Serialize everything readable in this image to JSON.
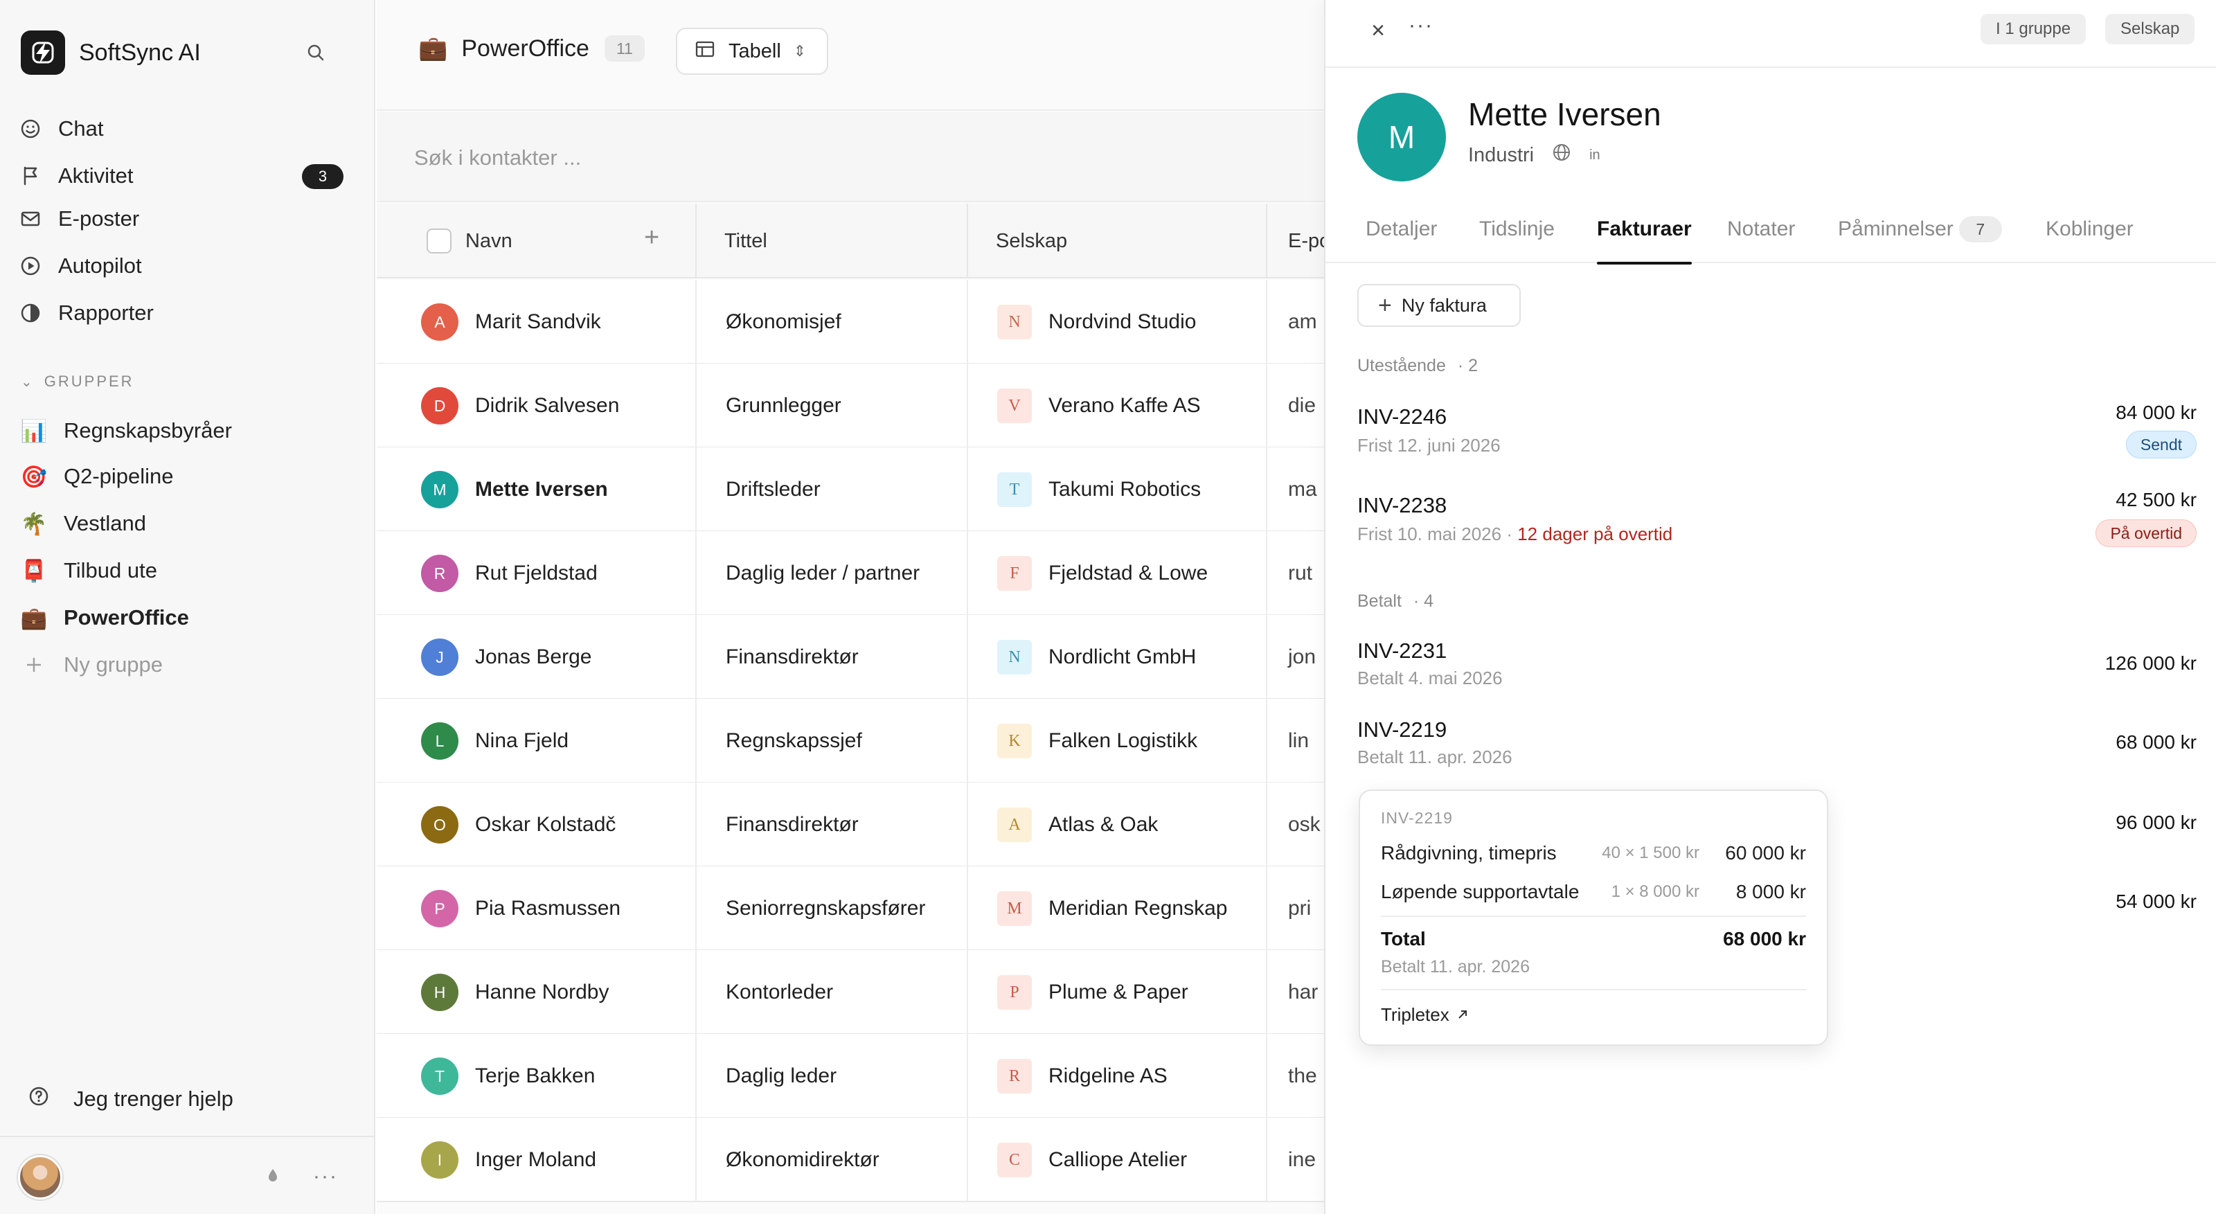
{
  "app": {
    "name": "SoftSync AI"
  },
  "nav": [
    {
      "label": "Chat",
      "icon": "smile-icon"
    },
    {
      "label": "Aktivitet",
      "icon": "flag-icon",
      "badge": "3"
    },
    {
      "label": "E-poster",
      "icon": "mail-icon"
    },
    {
      "label": "Autopilot",
      "icon": "play-circle-icon"
    },
    {
      "label": "Rapporter",
      "icon": "pie-chart-icon"
    }
  ],
  "groups": {
    "header": "GRUPPER",
    "items": [
      {
        "label": "Regnskapsbyråer",
        "emoji": "📊"
      },
      {
        "label": "Q2-pipeline",
        "emoji": "🎯"
      },
      {
        "label": "Vestland",
        "emoji": "🌴"
      },
      {
        "label": "Tilbud ute",
        "emoji": "📮"
      },
      {
        "label": "PowerOffice",
        "emoji": "💼"
      }
    ],
    "new_label": "Ny gruppe"
  },
  "help_label": "Jeg trenger hjelp",
  "main": {
    "title": "PowerOffice",
    "title_emoji": "💼",
    "count": "11",
    "view_label": "Tabell",
    "search_placeholder": "Søk i kontakter ...",
    "columns": [
      "Navn",
      "Tittel",
      "Selskap",
      "E-post"
    ],
    "rows": [
      {
        "initial": "A",
        "color": "#e4604a",
        "name": "Marit Sandvik",
        "title": "Økonomisjef",
        "logo": "N",
        "logo_bg": "#fde8e1",
        "logo_fg": "#c46a4a",
        "company": "Nordvind Studio",
        "email": "am"
      },
      {
        "initial": "D",
        "color": "#e14a3b",
        "name": "Didrik Salvesen",
        "title": "Grunnlegger",
        "logo": "V",
        "logo_bg": "#fde6e1",
        "logo_fg": "#c55c48",
        "company": "Verano Kaffe AS",
        "email": "die"
      },
      {
        "initial": "M",
        "color": "#17a19b",
        "name": "Mette Iversen",
        "title": "Driftsleder",
        "logo": "T",
        "logo_bg": "#dff3fb",
        "logo_fg": "#3a8fb0",
        "company": "Takumi Robotics",
        "email": "ma"
      },
      {
        "initial": "R",
        "color": "#c25aa5",
        "name": "Rut Fjeldstad",
        "title": "Daglig leder / partner",
        "logo": "F",
        "logo_bg": "#fde6e1",
        "logo_fg": "#c55c48",
        "company": "Fjeldstad & Lowe",
        "email": "rut"
      },
      {
        "initial": "J",
        "color": "#4f7fd6",
        "name": "Jonas Berge",
        "title": "Finansdirektør",
        "logo": "N",
        "logo_bg": "#dff3fb",
        "logo_fg": "#3a8fb0",
        "company": "Nordlicht GmbH",
        "email": "jon"
      },
      {
        "initial": "L",
        "color": "#2e8b4a",
        "name": "Nina Fjeld",
        "title": "Regnskapssjef",
        "logo": "K",
        "logo_bg": "#fdf0d8",
        "logo_fg": "#b5852e",
        "company": "Falken Logistikk",
        "email": "lin"
      },
      {
        "initial": "O",
        "color": "#8b6a12",
        "name": "Oskar Kolstadč",
        "title": "Finansdirektør",
        "logo": "A",
        "logo_bg": "#fdf0d8",
        "logo_fg": "#b5852e",
        "company": "Atlas & Oak",
        "email": "osk"
      },
      {
        "initial": "P",
        "color": "#d466a8",
        "name": "Pia Rasmussen",
        "title": "Seniorregnskapsfører",
        "logo": "M",
        "logo_bg": "#fde6e1",
        "logo_fg": "#c55c48",
        "company": "Meridian Regnskap",
        "email": "pri"
      },
      {
        "initial": "H",
        "color": "#5e7a3a",
        "name": "Hanne Nordby",
        "title": "Kontorleder",
        "logo": "P",
        "logo_bg": "#fde6e1",
        "logo_fg": "#c55c48",
        "company": "Plume & Paper",
        "email": "har"
      },
      {
        "initial": "T",
        "color": "#3fb89a",
        "name": "Terje Bakken",
        "title": "Daglig leder",
        "logo": "R",
        "logo_bg": "#fde6e1",
        "logo_fg": "#c55c48",
        "company": "Ridgeline AS",
        "email": "the"
      },
      {
        "initial": "I",
        "color": "#a8a64a",
        "name": "Inger Moland",
        "title": "Økonomidirektør",
        "logo": "C",
        "logo_bg": "#fde6e1",
        "logo_fg": "#c55c48",
        "company": "Calliope Atelier",
        "email": "ine"
      }
    ]
  },
  "panel": {
    "chips": [
      "I 1 gruppe",
      "Selskap"
    ],
    "initial": "M",
    "name": "Mette Iversen",
    "industry": "Industri",
    "linkedin": "in",
    "tabs": [
      "Detaljer",
      "Tidslinje",
      "Fakturaer",
      "Notater",
      "Påminnelser",
      "Koblinger"
    ],
    "reminder_count": "7",
    "new_invoice_label": "Ny faktura",
    "outstanding": {
      "label": "Utestående",
      "count": "· 2",
      "invoices": [
        {
          "no": "INV-2246",
          "sub": "Frist 12. juni 2026",
          "amount": "84 000 kr",
          "status": "Sendt"
        },
        {
          "no": "INV-2238",
          "sub": "Frist 10. mai 2026 ·",
          "overdue_note": "12 dager på overtid",
          "amount": "42 500 kr",
          "status": "På overtid"
        }
      ]
    },
    "paid": {
      "label": "Betalt",
      "count": "· 4",
      "invoices": [
        {
          "no": "INV-2231",
          "sub": "Betalt 4. mai 2026",
          "amount": "126 000 kr"
        },
        {
          "no": "INV-2219",
          "sub": "Betalt 11. apr. 2026",
          "amount": "68 000 kr"
        }
      ],
      "extra_amounts": [
        "96 000 kr",
        "54 000 kr"
      ]
    },
    "popover": {
      "id": "INV-2219",
      "lines": [
        {
          "desc": "Rådgivning, timepris",
          "qty": "40 × 1 500 kr",
          "amount": "60 000 kr"
        },
        {
          "desc": "Løpende supportavtale",
          "qty": "1 × 8 000 kr",
          "amount": "8 000 kr"
        }
      ],
      "total_label": "Total",
      "total": "68 000 kr",
      "paid": "Betalt 11. apr. 2026",
      "link": "Tripletex"
    }
  }
}
